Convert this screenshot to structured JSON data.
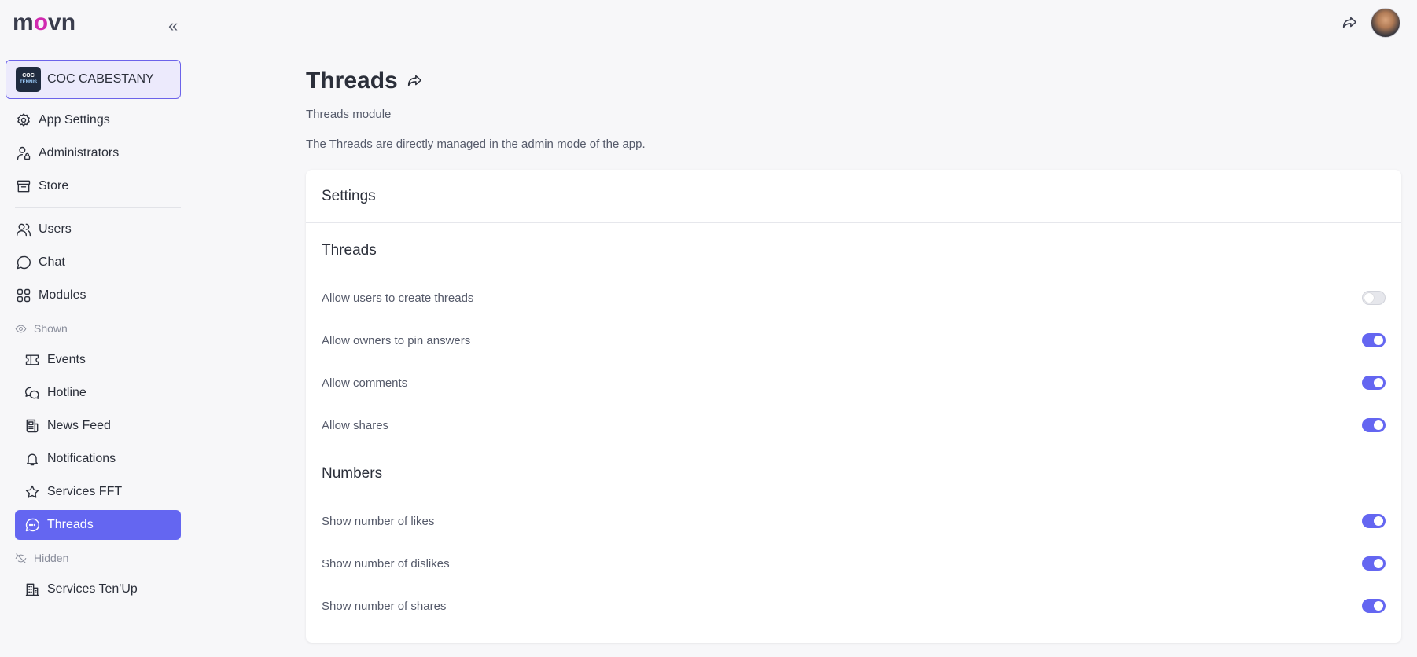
{
  "brand": {
    "name": "movn",
    "accent": "#d12bb0",
    "primary": "#6466f1"
  },
  "sidebar": {
    "org": {
      "logo_text": "COC",
      "logo_sub": "TENNIS",
      "name": "COC CABESTANY"
    },
    "admin_items": [
      {
        "label": "App Settings",
        "icon": "gear-icon"
      },
      {
        "label": "Administrators",
        "icon": "admin-user-icon"
      },
      {
        "label": "Store",
        "icon": "store-icon"
      }
    ],
    "main_items": [
      {
        "label": "Users",
        "icon": "users-icon"
      },
      {
        "label": "Chat",
        "icon": "chat-icon"
      },
      {
        "label": "Modules",
        "icon": "modules-icon"
      }
    ],
    "shown_label": "Shown",
    "shown_items": [
      {
        "label": "Events",
        "icon": "ticket-icon"
      },
      {
        "label": "Hotline",
        "icon": "hotline-icon"
      },
      {
        "label": "News Feed",
        "icon": "newspaper-icon"
      },
      {
        "label": "Notifications",
        "icon": "bell-icon"
      },
      {
        "label": "Services FFT",
        "icon": "star-icon"
      },
      {
        "label": "Threads",
        "icon": "threads-icon",
        "active": true
      }
    ],
    "hidden_label": "Hidden",
    "hidden_items": [
      {
        "label": "Services Ten'Up",
        "icon": "building-icon"
      }
    ]
  },
  "main": {
    "title": "Threads",
    "subtitle": "Threads module",
    "description": "The Threads are directly managed in the admin mode of the app.",
    "card": {
      "header": "Settings",
      "sections": [
        {
          "title": "Threads",
          "toggles": [
            {
              "label": "Allow users to create threads",
              "on": false
            },
            {
              "label": "Allow owners to pin answers",
              "on": true
            },
            {
              "label": "Allow comments",
              "on": true
            },
            {
              "label": "Allow shares",
              "on": true
            }
          ]
        },
        {
          "title": "Numbers",
          "toggles": [
            {
              "label": "Show number of likes",
              "on": true
            },
            {
              "label": "Show number of dislikes",
              "on": true
            },
            {
              "label": "Show number of shares",
              "on": true
            }
          ]
        }
      ]
    }
  }
}
